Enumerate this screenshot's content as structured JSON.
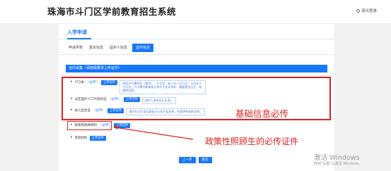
{
  "header": {
    "site_title": "珠海市斗门区学前教育招生系统",
    "logout_label": "退出登录"
  },
  "section": {
    "title": "入学申请"
  },
  "tabs": [
    {
      "label": "申请学校",
      "active": false
    },
    {
      "label": "基本信息",
      "active": false
    },
    {
      "label": "监护人信息",
      "active": false
    },
    {
      "label": "证件信息",
      "active": true
    }
  ],
  "upload": {
    "header": "证件采集（请按需要求上传证件）",
    "rows": [
      {
        "label": "户口本",
        "required": "（必传）",
        "button": "上传证件",
        "tip": "家庭户口簿首页（首页）、户主页、幼儿本人户口页、父母本人户口页。户口簿不能体现父母与子女关系的，需要提交出生、结婚等证明。"
      },
      {
        "label": "法定监护人二代身份证",
        "required": "（必传）",
        "button": "上传证件",
        "tip": "监护人身份证正反面。"
      },
      {
        "label": "幼儿出生证",
        "required": "（必传）",
        "button": "上传证件",
        "tip": "请先在出生证后面标注父母子女关系，并提供有效的证明。"
      },
      {
        "label": "政策性照顾材料",
        "required": "（必传）",
        "button": "上传证件",
        "tip": ""
      },
      {
        "label": "其他材料",
        "required": "",
        "button": "上传证件",
        "tip": ""
      }
    ]
  },
  "annotations": {
    "basic_info": "基础信息必传",
    "policy": "政策性照顾生的必传证件"
  },
  "footer": {
    "prev_label": "上一步",
    "submit_label": "提交"
  },
  "watermark": {
    "title": "激活 Windows",
    "subtitle": "转到\"设置\"以激活 Windows。"
  },
  "colors": {
    "accent": "#1677ff",
    "annotation_red": "#e02020",
    "background": "#f2f2f2"
  }
}
